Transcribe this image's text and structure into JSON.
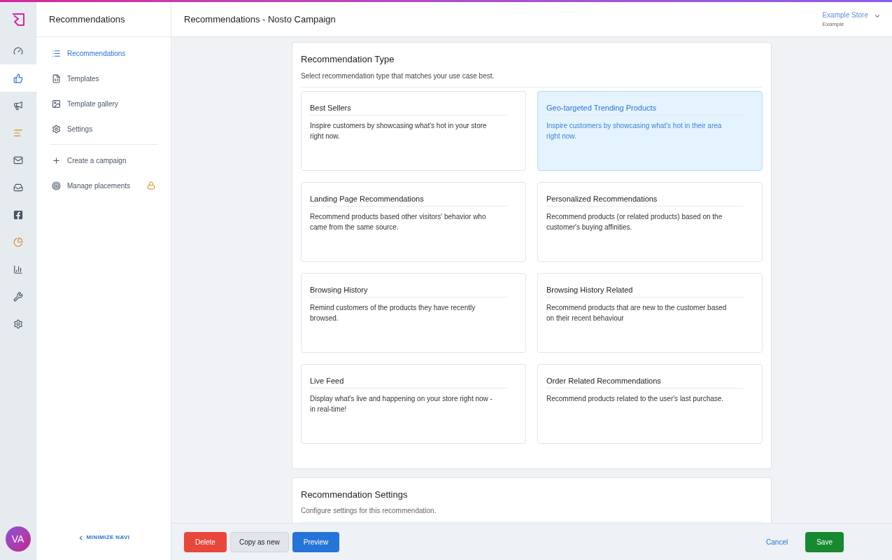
{
  "rail": {
    "items": [
      {
        "selected": false
      },
      {
        "selected": true
      },
      {
        "selected": false
      },
      {
        "selected": false
      },
      {
        "selected": false
      },
      {
        "selected": false
      },
      {
        "selected": false
      },
      {
        "selected": false
      },
      {
        "selected": false
      },
      {
        "selected": false
      },
      {
        "selected": false
      }
    ],
    "avatar": "VA"
  },
  "sidebar": {
    "title": "Recommendations",
    "items": [
      {
        "label": "Recommendations",
        "selected": true
      },
      {
        "label": "Templates",
        "selected": false
      },
      {
        "label": "Template gallery",
        "selected": false
      },
      {
        "label": "Settings",
        "selected": false
      }
    ],
    "actions": [
      {
        "label": "Create a campaign",
        "locked": false
      },
      {
        "label": "Manage placements",
        "locked": true
      }
    ],
    "minimize": "MINIMIZE NAVI"
  },
  "header": {
    "title": "Recommendations - Nosto Campaign",
    "store": "Example Store",
    "store_sub": "Example"
  },
  "type_section": {
    "title": "Recommendation Type",
    "subtitle": "Select recommendation type that matches your use case best.",
    "options": [
      {
        "title": "Best Sellers",
        "description": "Inspire customers by showcasing what's hot in your store right now.",
        "selected": false
      },
      {
        "title": "Geo-targeted Trending Products",
        "description": "Inspire customers by showcasing what's hot in their area right now.",
        "selected": true
      },
      {
        "title": "Landing Page Recommendations",
        "description": "Recommend products based other visitors' behavior who came from the same source.",
        "selected": false
      },
      {
        "title": "Personalized Recommendations",
        "description": "Recommend products (or related products) based on the customer's buying affinities.",
        "selected": false
      },
      {
        "title": "Browsing History",
        "description": "Remind customers of the products they have recently browsed.",
        "selected": false
      },
      {
        "title": "Browsing History Related",
        "description": "Recommend products that are new to the customer based on their recent behaviour",
        "selected": false
      },
      {
        "title": "Live Feed",
        "description": "Display what's live and happening on your store right now - in real-time!",
        "selected": false
      },
      {
        "title": "Order Related Recommendations",
        "description": "Recommend products related to the user's last purchase.",
        "selected": false
      }
    ]
  },
  "settings_section": {
    "title": "Recommendation Settings",
    "subtitle": "Configure settings for this recommendation."
  },
  "footer": {
    "left": [
      {
        "label": "Delete",
        "kind": "danger"
      },
      {
        "label": "Copy as new",
        "kind": "secondary"
      },
      {
        "label": "Preview",
        "kind": "primary"
      }
    ],
    "right": [
      {
        "label": "Cancel",
        "kind": "link"
      },
      {
        "label": "Save",
        "kind": "success"
      }
    ]
  }
}
